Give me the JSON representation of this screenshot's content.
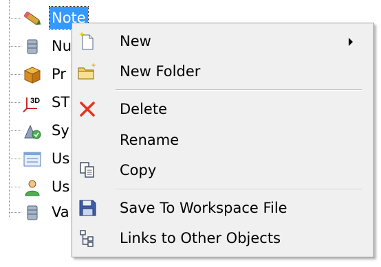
{
  "tree": {
    "items": [
      {
        "label": "Note",
        "icon": "pencil-icon"
      },
      {
        "label": "Nu",
        "icon": "database-icon"
      },
      {
        "label": "Pr",
        "icon": "package-icon"
      },
      {
        "label": "ST",
        "icon": "axes-3d-icon",
        "icon_text": "3D"
      },
      {
        "label": "Sy",
        "icon": "system-icon"
      },
      {
        "label": "Us",
        "icon": "form-icon"
      },
      {
        "label": "Us",
        "icon": "user-icon"
      },
      {
        "label": "Va",
        "icon": "database-icon"
      }
    ]
  },
  "context_menu": {
    "items": [
      {
        "label": "New",
        "icon": "new-document-icon",
        "has_submenu": true
      },
      {
        "label": "New Folder",
        "icon": "new-folder-icon"
      },
      {
        "label": "Delete",
        "icon": "delete-icon"
      },
      {
        "label": "Rename"
      },
      {
        "label": "Copy",
        "icon": "copy-icon"
      },
      {
        "label": "Save To Workspace File",
        "icon": "save-icon"
      },
      {
        "label": "Links to Other Objects",
        "icon": "links-tree-icon"
      }
    ]
  },
  "colors": {
    "selection": "#3399ff",
    "menu_background": "#f0f0f0",
    "delete_red": "#e8311d"
  }
}
